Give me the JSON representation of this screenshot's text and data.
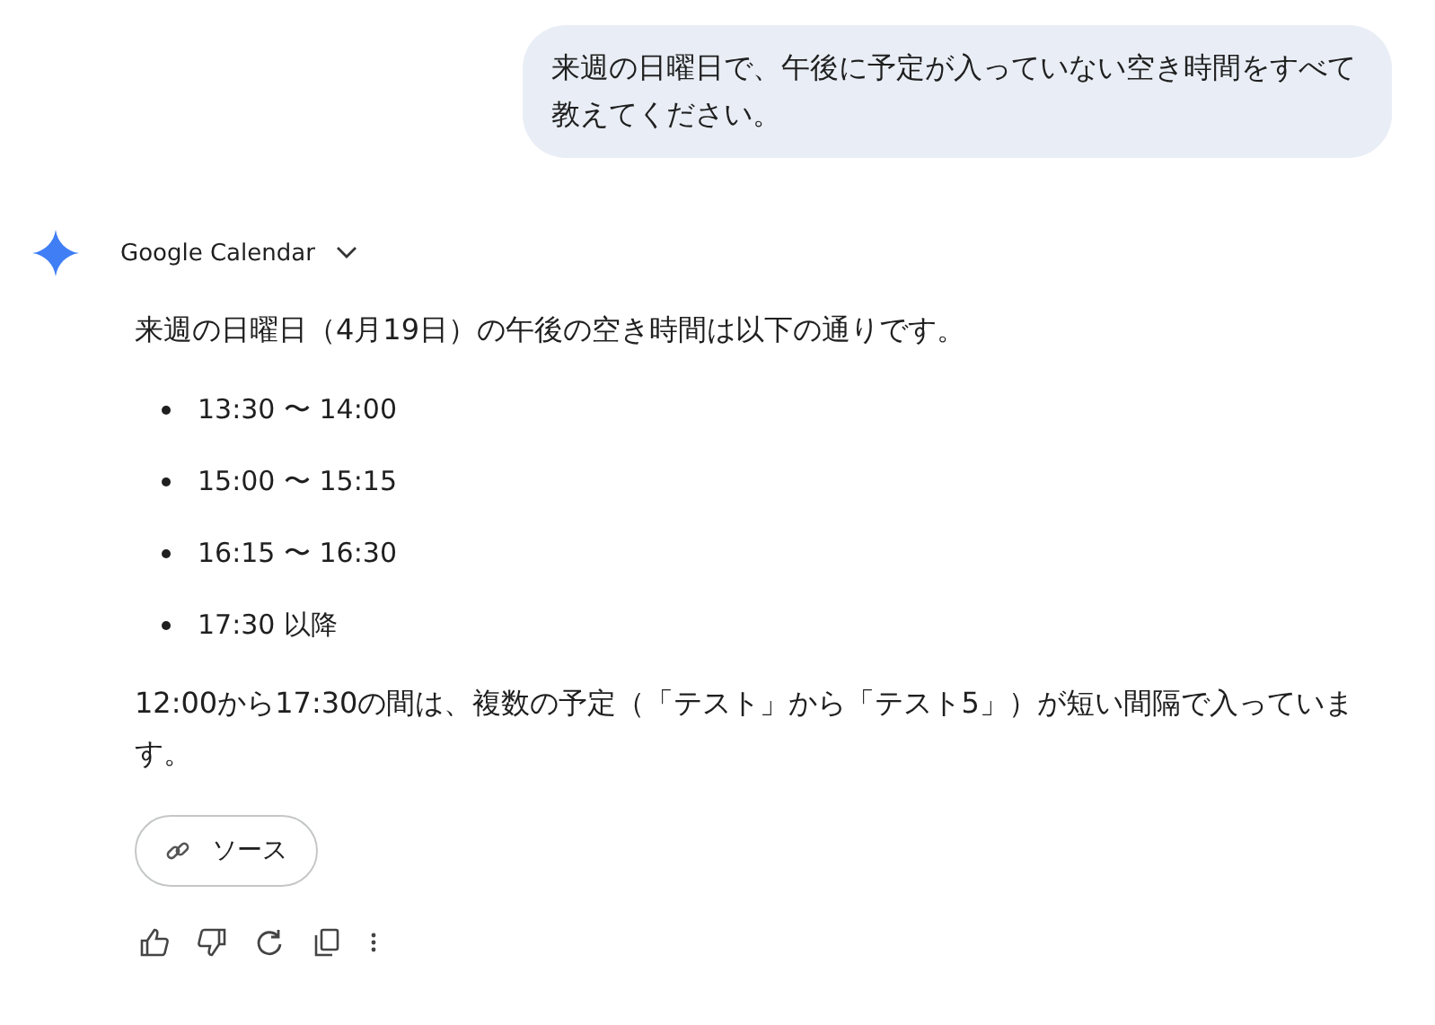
{
  "user_message": "来週の日曜日で、午後に予定が入っていない空き時間をすべて教えてください。",
  "response": {
    "source_name": "Google Calendar",
    "intro": "来週の日曜日（4月19日）の午後の空き時間は以下の通りです。",
    "free_slots": [
      "13:30 〜 14:00",
      "15:00 〜 15:15",
      "16:15 〜 16:30",
      "17:30 以降"
    ],
    "note": "12:00から17:30の間は、複数の予定（「テスト」から「テスト5」）が短い間隔で入っています。",
    "source_button": "ソース"
  }
}
